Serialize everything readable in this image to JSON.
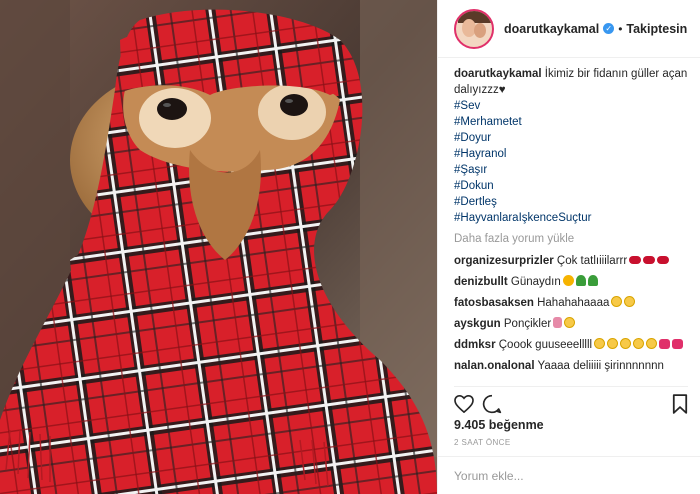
{
  "post": {
    "username": "doarutkaykamal",
    "separator": "•",
    "follow_label": "Takiptesin",
    "caption_user": "doarutkaykamal",
    "caption_text": "İkimiz bir fidanın güller açan dalıyızzz♥",
    "hashtags": [
      "#Sev",
      "#Merhametet",
      "#Doyur",
      "#Hayranol",
      "#Şaşır",
      "#Dokun",
      "#Dertleş",
      "#HayvanlaraIşkenceSuçtur"
    ],
    "load_more": "Daha fazla yorum yükle",
    "likes": "9.405 beğenme",
    "time": "2 SAAT ÖNCE",
    "comment_placeholder": "Yorum ekle..."
  },
  "comments": [
    {
      "user": "organizesurprizler",
      "text": "Çok tatlıiiilarrr",
      "emojis": [
        "e-lips",
        "e-lips",
        "e-lips"
      ]
    },
    {
      "user": "denizbullt",
      "text": "Günaydın",
      "emojis": [
        "e-sun",
        "e-tree",
        "e-tree"
      ]
    },
    {
      "user": "fatosbasaksen",
      "text": "Hahahahaaaa",
      "emojis": [
        "e-face",
        "e-face"
      ]
    },
    {
      "user": "ayskgun",
      "text": "Ponçikler",
      "emojis": [
        "e-nail",
        "e-face"
      ]
    },
    {
      "user": "ddmksr",
      "text": "Çoook guuseeelllll",
      "emojis": [
        "e-face",
        "e-face",
        "e-face",
        "e-face",
        "e-face",
        "e-heart",
        "e-heart"
      ]
    },
    {
      "user": "nalan.onalonal",
      "text": "Yaaaa deliiiii şirinnnnnnn",
      "emojis": []
    }
  ],
  "icons": {
    "verified": "verified-badge-icon",
    "like": "heart-icon",
    "comment": "comment-bubble-icon",
    "save": "bookmark-icon"
  },
  "colors": {
    "blanket_red": "#d8202a",
    "hashtag": "#003569",
    "verified": "#3897f0",
    "muted": "#999999"
  }
}
